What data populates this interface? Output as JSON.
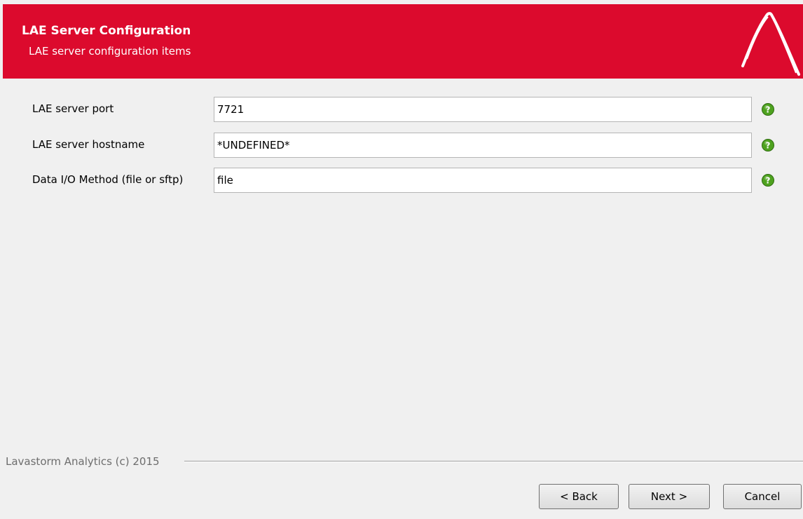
{
  "header": {
    "title": "LAE Server Configuration",
    "subtitle": "LAE server configuration items",
    "background_color": "#dc0a2d"
  },
  "fields": [
    {
      "label": "LAE server port",
      "value": "7721",
      "help_icon": "green-question-icon"
    },
    {
      "label": "LAE server hostname",
      "value": "*UNDEFINED*",
      "help_icon": "green-question-icon"
    },
    {
      "label": "Data I/O Method (file or sftp)",
      "value": "file",
      "help_icon": "green-question-icon"
    }
  ],
  "footer": {
    "copyright": "Lavastorm Analytics (c) 2015"
  },
  "buttons": {
    "back": "< Back",
    "next": "Next >",
    "cancel": "Cancel"
  }
}
